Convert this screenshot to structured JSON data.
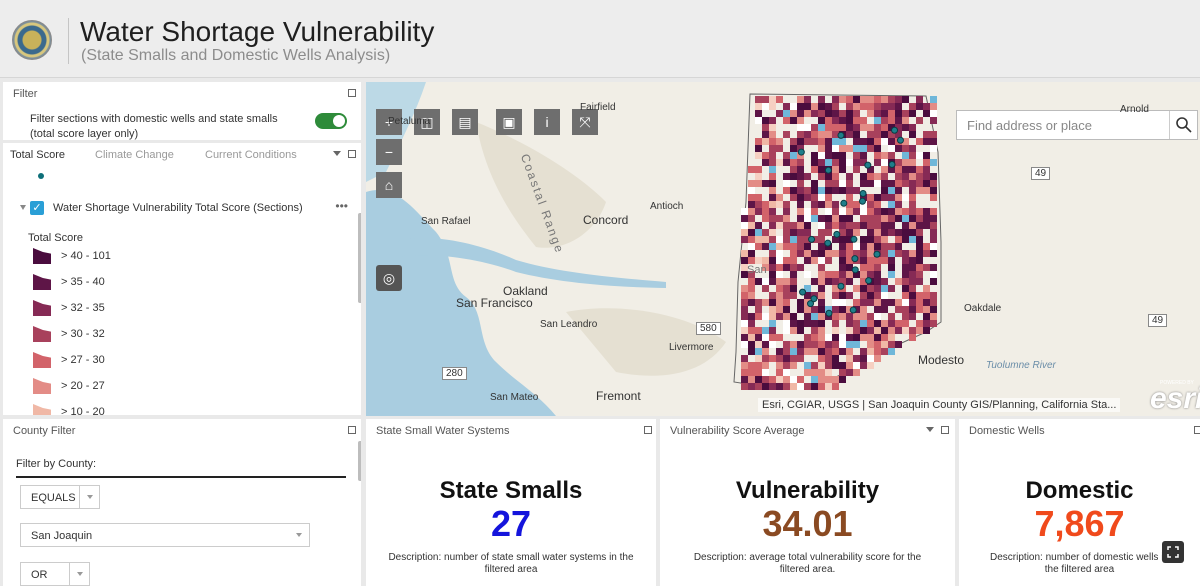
{
  "header": {
    "title": "Water Shortage Vulnerability",
    "subtitle": "(State Smalls and Domestic Wells Analysis)"
  },
  "filter_panel": {
    "title": "Filter",
    "toggle_text": "Filter sections with domestic wells and state smalls (total score layer only)",
    "toggle_on": true
  },
  "legend_panel": {
    "tabs": [
      "Total Score",
      "Climate Change",
      "Current Conditions"
    ],
    "layer_name": "Water Shortage Vulnerability Total Score (Sections)",
    "layer_checked": true,
    "legend_heading": "Total Score",
    "items": [
      {
        "label": "> 40 - 101",
        "color": "#4a0c3e"
      },
      {
        "label": "> 35 - 40",
        "color": "#5e1547"
      },
      {
        "label": "> 32 - 35",
        "color": "#862a55"
      },
      {
        "label": "> 30 - 32",
        "color": "#a8415c"
      },
      {
        "label": "> 27 - 30",
        "color": "#d2636a"
      },
      {
        "label": "> 20 - 27",
        "color": "#e38c86"
      },
      {
        "label": "> 10 - 20",
        "color": "#f0b8a6"
      }
    ]
  },
  "county_panel": {
    "title": "County Filter",
    "label": "Filter by County:",
    "operator1": "EQUALS",
    "county_value": "San Joaquin",
    "operator2": "OR"
  },
  "map": {
    "search_placeholder": "Find address or place",
    "places": [
      "Fairfield",
      "Petaluma",
      "Antioch",
      "Concord",
      "San Rafael",
      "Coastal Range",
      "Oakland",
      "San Francisco",
      "San Leandro",
      "Livermore",
      "San Mateo",
      "Fremont",
      "Oakdale",
      "Modesto",
      "Tuolumne River",
      "Arnold",
      "San"
    ],
    "highway_shields": [
      "49",
      "580",
      "280",
      "49"
    ],
    "attribution": "Esri, CGIAR, USGS | San Joaquin County GIS/Planning, California Sta...",
    "esri_logo": "esri",
    "esri_powered": "POWERED BY",
    "tool_icons": [
      "zoom-in-icon",
      "zoom-out-icon",
      "home-icon",
      "locate-icon",
      "layer-swipe-icon",
      "print-icon",
      "bookmark-icon",
      "info-icon",
      "share-icon"
    ],
    "colors": {
      "water": "#a9cde0",
      "land": "#f1eee6"
    }
  },
  "indicators": [
    {
      "panel_title": "State Small Water Systems",
      "title": "State Smalls",
      "value": "27",
      "value_color": "#1414dc",
      "description": "Description: number of state small water systems in the filtered area"
    },
    {
      "panel_title": "Vulnerability Score Average",
      "title": "Vulnerability",
      "value": "34.01",
      "value_color": "#8a4a22",
      "description": "Description: average total vulnerability score for the filtered area."
    },
    {
      "panel_title": "Domestic Wells",
      "title": "Domestic",
      "value": "7,867",
      "value_color": "#f04a1c",
      "description": "Description: number of domestic wells in the filtered area"
    }
  ]
}
